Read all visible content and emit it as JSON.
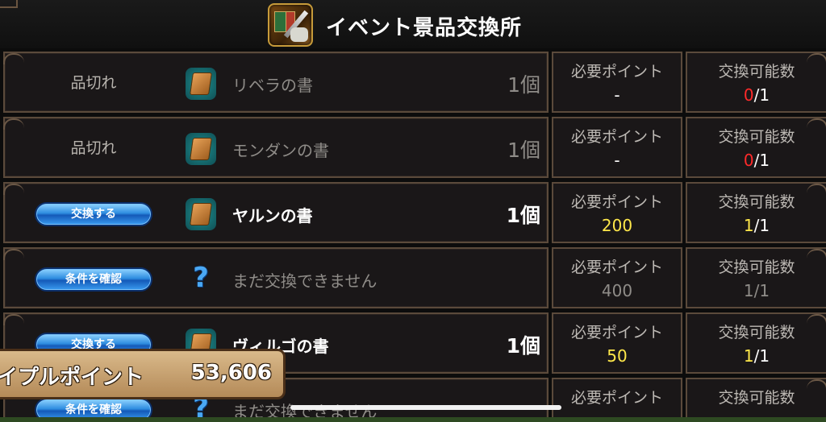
{
  "header": {
    "title": "イベント景品交換所",
    "icon": "event-exchange-icon"
  },
  "columns": {
    "points_label": "必要ポイント",
    "count_label": "交換可能数"
  },
  "rows": [
    {
      "status": "品切れ",
      "action": null,
      "icon": "book-icon",
      "item_name": "リベラの書",
      "quantity": "1個",
      "active": false,
      "points": "-",
      "count_used": "0",
      "count_sep": "/",
      "count_max": "1"
    },
    {
      "status": "品切れ",
      "action": null,
      "icon": "book-icon",
      "item_name": "モンダンの書",
      "quantity": "1個",
      "active": false,
      "points": "-",
      "count_used": "0",
      "count_sep": "/",
      "count_max": "1"
    },
    {
      "status": null,
      "action": "交換する",
      "icon": "book-icon",
      "item_name": "ヤルンの書",
      "quantity": "1個",
      "active": true,
      "points": "200",
      "count_used": "1",
      "count_sep": "/",
      "count_max": "1"
    },
    {
      "status": null,
      "action": "条件を確認",
      "icon": "question-icon",
      "item_name": "まだ交換できません",
      "quantity": "",
      "active": false,
      "points": "400",
      "count_used": "1",
      "count_sep": "/",
      "count_max": "1"
    },
    {
      "status": null,
      "action": "交換する",
      "icon": "book-icon",
      "item_name": "ヴィルゴの書",
      "quantity": "1個",
      "active": true,
      "points": "50",
      "count_used": "1",
      "count_sep": "/",
      "count_max": "1"
    },
    {
      "status": null,
      "action": "条件を確認",
      "icon": "question-icon",
      "item_name": "まだ交換できません",
      "quantity": "",
      "active": false,
      "points": "",
      "count_used": "",
      "count_sep": "",
      "count_max": ""
    }
  ],
  "points_bar": {
    "label": "イプルポイント",
    "value": "53,606"
  },
  "colors": {
    "used_zero": "#ff2a2a",
    "used_active": "#ffe84a",
    "points_active": "#ffe84a",
    "button_blue": "#2e8de0"
  }
}
